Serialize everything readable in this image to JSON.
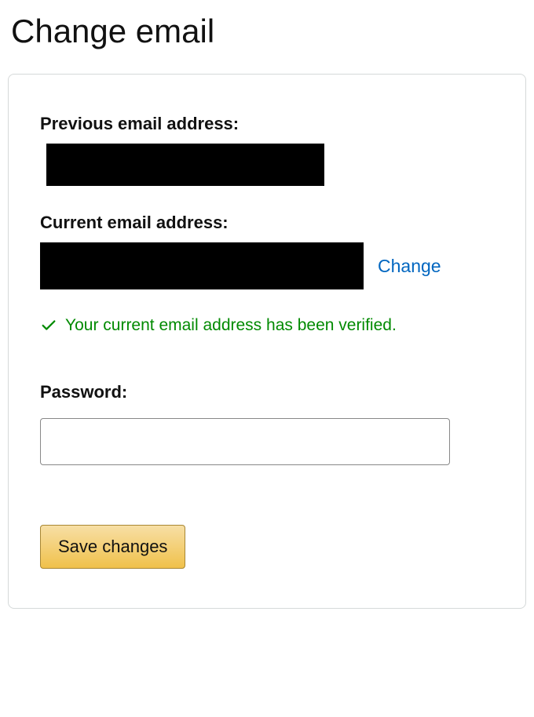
{
  "page": {
    "title": "Change email"
  },
  "form": {
    "previousLabel": "Previous email address:",
    "currentLabel": "Current email address:",
    "changeLink": "Change",
    "verifiedMessage": "Your current email address has been verified.",
    "passwordLabel": "Password:",
    "passwordValue": "",
    "saveButton": "Save changes"
  }
}
